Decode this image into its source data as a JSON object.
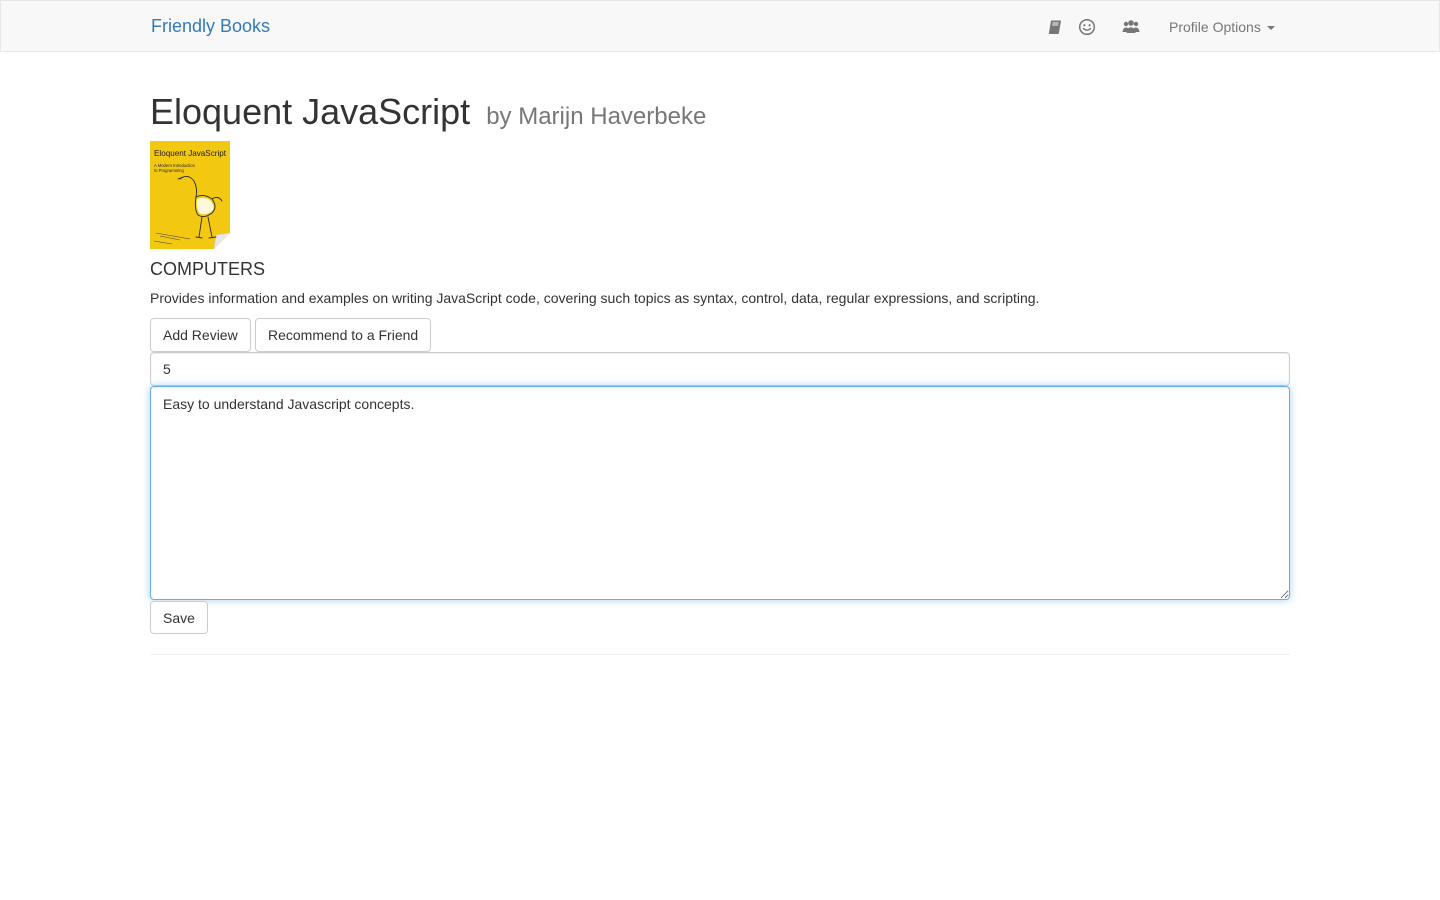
{
  "navbar": {
    "brand": "Friendly Books",
    "icons": [
      "book-icon",
      "smile-icon",
      "users-icon"
    ],
    "profile_options": "Profile Options"
  },
  "book": {
    "title": "Eloquent JavaScript",
    "author_line": "by Marijn Haverbeke",
    "cover_text": {
      "title": "Eloquent JavaScript",
      "subtitle_1": "A Modern Introduction",
      "subtitle_2": "to Programming"
    },
    "category": "COMPUTERS",
    "description": "Provides information and examples on writing JavaScript code, covering such topics as syntax, control, data, regular expressions, and scripting."
  },
  "actions": {
    "add_review": "Add Review",
    "recommend": "Recommend to a Friend"
  },
  "review_form": {
    "rating_value": "5",
    "review_text": "Easy to understand Javascript concepts.",
    "save_label": "Save"
  },
  "colors": {
    "brand": "#337ab7",
    "navbar_bg": "#f8f8f8",
    "cover_yellow": "#f2c811",
    "focus_border": "#66afe9"
  }
}
